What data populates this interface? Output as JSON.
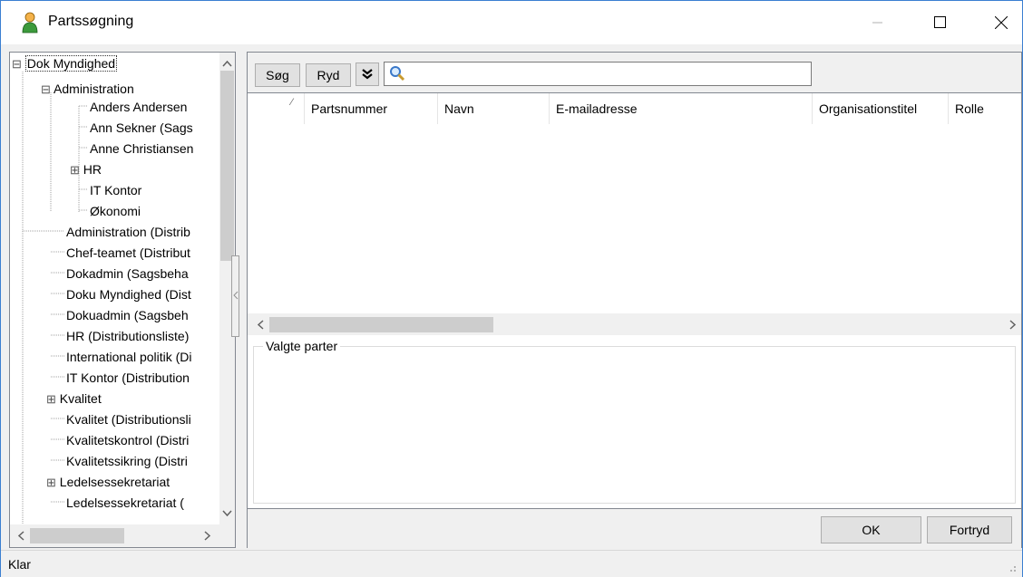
{
  "window": {
    "title": "Partssøgning"
  },
  "titlebar": {
    "minimize_icon": "minimize-icon",
    "maximize_icon": "maximize-icon",
    "close_icon": "close-icon"
  },
  "tree": {
    "items": [
      {
        "label": "Dok Myndighed",
        "expander": "⊟"
      },
      {
        "label": "Administration",
        "expander": "⊟"
      },
      {
        "label": "Anders Andersen",
        "expander": ""
      },
      {
        "label": "Ann Sekner (Sags",
        "expander": ""
      },
      {
        "label": "Anne Christiansen",
        "expander": ""
      },
      {
        "label": "HR",
        "expander": "⊞"
      },
      {
        "label": "IT Kontor",
        "expander": ""
      },
      {
        "label": "Økonomi",
        "expander": ""
      },
      {
        "label": "Administration (Distrib",
        "expander": ""
      },
      {
        "label": "Chef-teamet (Distribut",
        "expander": ""
      },
      {
        "label": "Dokadmin (Sagsbeha",
        "expander": ""
      },
      {
        "label": "Doku Myndighed (Dist",
        "expander": ""
      },
      {
        "label": "Dokuadmin (Sagsbeh",
        "expander": ""
      },
      {
        "label": "HR (Distributionsliste)",
        "expander": ""
      },
      {
        "label": "International politik (Di",
        "expander": ""
      },
      {
        "label": "IT Kontor (Distribution",
        "expander": ""
      },
      {
        "label": "Kvalitet",
        "expander": "⊞"
      },
      {
        "label": "Kvalitet (Distributionsli",
        "expander": ""
      },
      {
        "label": "Kvalitetskontrol (Distri",
        "expander": ""
      },
      {
        "label": "Kvalitetssikring (Distri",
        "expander": ""
      },
      {
        "label": "Ledelsessekretariat",
        "expander": "⊞"
      },
      {
        "label": "Ledelsessekretariat (",
        "expander": ""
      }
    ]
  },
  "toolbar": {
    "search_label": "Søg",
    "clear_label": "Ryd",
    "expand_icon": "double-chevron-down-icon",
    "search_value": "",
    "search_icon": "magnifier-icon"
  },
  "grid": {
    "columns": [
      "Partsnummer",
      "Navn",
      "E-mailadresse",
      "Organisationstitel",
      "Rolle"
    ],
    "rows": []
  },
  "selected": {
    "legend": "Valgte parter"
  },
  "footer": {
    "ok_label": "OK",
    "cancel_label": "Fortryd"
  },
  "status": {
    "text": "Klar"
  },
  "colors": {
    "border_accent": "#3b7fd1",
    "panel_bg": "#f0f0f0",
    "button_bg": "#e1e1e1"
  }
}
